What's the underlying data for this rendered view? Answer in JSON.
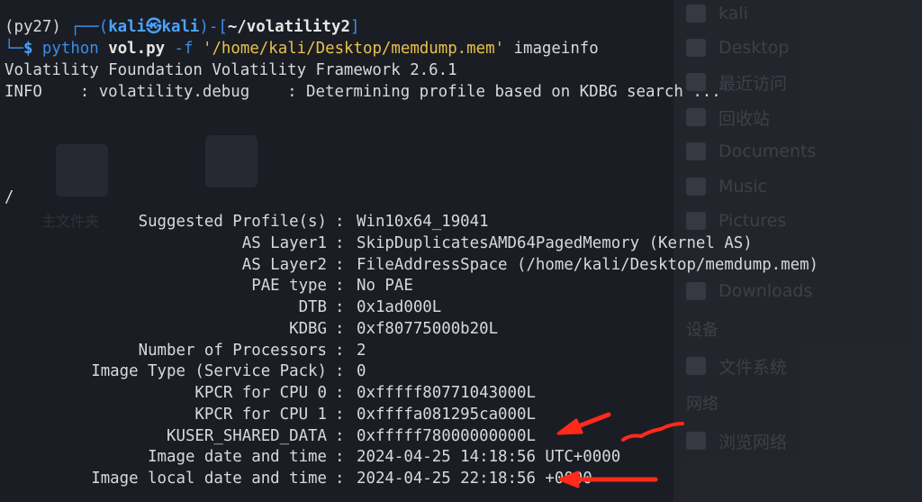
{
  "prompt": {
    "venv": "(py27)",
    "corner": "┌──(",
    "user": "kali",
    "at_glyph": "㉿",
    "host": "kali",
    "bracket_mid": ")-[",
    "cwd": "~/volatility2",
    "bracket_end": "]",
    "line2_prefix": "└─",
    "dollar": "$"
  },
  "command": {
    "program": "python",
    "script": "vol.py",
    "flag": "-f",
    "path_arg": "'/home/kali/Desktop/memdump.mem'",
    "plugin": "imageinfo"
  },
  "output": {
    "banner": "Volatility Foundation Volatility Framework 2.6.1",
    "info_line": "INFO    : volatility.debug    : Determining profile based on KDBG search ...",
    "slash": "/"
  },
  "imageinfo": [
    {
      "key": "Suggested Profile(s)",
      "value": "Win10x64_19041"
    },
    {
      "key": "AS Layer1",
      "value": "SkipDuplicatesAMD64PagedMemory (Kernel AS)"
    },
    {
      "key": "AS Layer2",
      "value": "FileAddressSpace (/home/kali/Desktop/memdump.mem)"
    },
    {
      "key": "PAE type",
      "value": "No PAE"
    },
    {
      "key": "DTB",
      "value": "0x1ad000L"
    },
    {
      "key": "KDBG",
      "value": "0xf80775000b20L"
    },
    {
      "key": "Number of Processors",
      "value": "2"
    },
    {
      "key": "Image Type (Service Pack)",
      "value": "0"
    },
    {
      "key": "KPCR for CPU 0",
      "value": "0xfffff80771043000L"
    },
    {
      "key": "KPCR for CPU 1",
      "value": "0xffffa081295ca000L"
    },
    {
      "key": "KUSER_SHARED_DATA",
      "value": "0xfffff78000000000L"
    },
    {
      "key": "Image date and time",
      "value": "2024-04-25 14:18:56 UTC+0000"
    },
    {
      "key": "Image local date and time",
      "value": "2024-04-25 22:18:56 +0000"
    }
  ],
  "background_desktop": {
    "sidebar_items": [
      "kali",
      "Desktop",
      "最近访问",
      "回收站",
      "Documents",
      "Music",
      "Pictures",
      "Downloads"
    ],
    "devices_header": "设备",
    "devices_items": [
      "文件系统"
    ],
    "network_header": "网络",
    "network_items": [
      "浏览网络"
    ],
    "desktop_label": "主文件夹"
  },
  "colors": {
    "background": "#1b1d24",
    "text": "#d7d9de",
    "prompt_blue": "#3b8eea",
    "string_yellow": "#e8c24a",
    "annotation_red": "#ff2a1a"
  }
}
